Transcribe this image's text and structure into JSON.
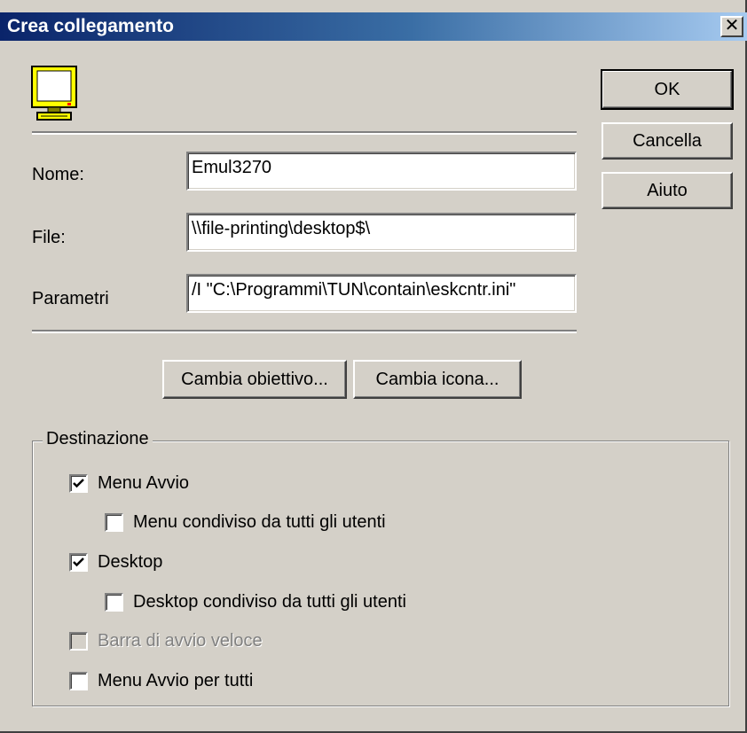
{
  "window": {
    "title": "Crea collegamento",
    "close_label": "✕"
  },
  "icon": "monitor-icon",
  "fields": {
    "name_label": "Nome:",
    "name_value": "Emul3270",
    "file_label": "File:",
    "file_value": "\\\\file-printing\\desktop$\\",
    "params_label": "Parametri",
    "params_value": "/I \"C:\\Programmi\\TUN\\contain\\eskcntr.ini\""
  },
  "buttons": {
    "ok": "OK",
    "cancel": "Cancella",
    "help": "Aiuto",
    "change_target": "Cambia obiettivo...",
    "change_icon": "Cambia icona..."
  },
  "destination": {
    "legend": "Destinazione",
    "options": [
      {
        "label": "Menu Avvio",
        "checked": true,
        "enabled": true
      },
      {
        "label": "Menu condiviso da tutti gli utenti",
        "checked": false,
        "enabled": true
      },
      {
        "label": "Desktop",
        "checked": true,
        "enabled": true
      },
      {
        "label": "Desktop condiviso da tutti gli utenti",
        "checked": false,
        "enabled": true
      },
      {
        "label": "Barra di avvio veloce",
        "checked": false,
        "enabled": false
      },
      {
        "label": "Menu Avvio per tutti",
        "checked": false,
        "enabled": true
      }
    ]
  },
  "colors": {
    "face": "#d4d0c8",
    "title_start": "#0a246a",
    "title_end": "#a6caf0"
  }
}
